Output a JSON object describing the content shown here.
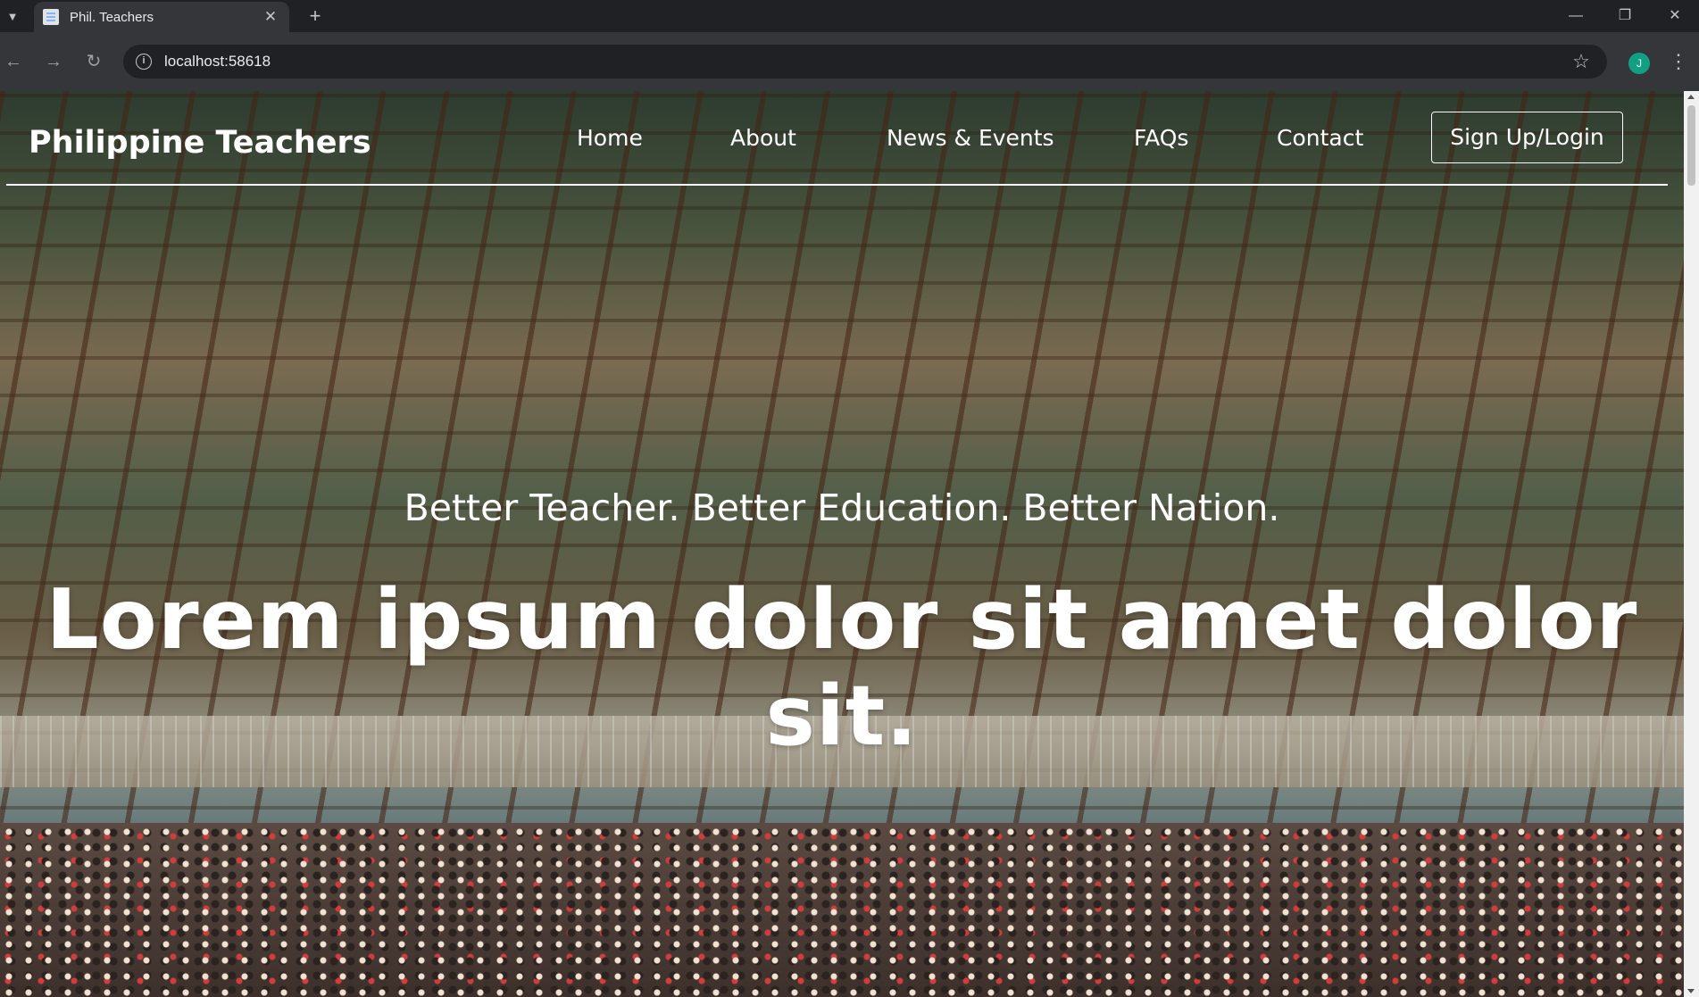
{
  "browser": {
    "tab_title": "Phil. Teachers",
    "url": "localhost:58618",
    "avatar_initial": "J"
  },
  "site": {
    "brand": "Philippine Teachers",
    "nav": [
      "Home",
      "About",
      "News & Events",
      "FAQs",
      "Contact"
    ],
    "signup_label": "Sign Up/Login"
  },
  "hero": {
    "tagline": "Better Teacher. Better Education. Better Nation.",
    "headline": "Lorem ipsum dolor sit amet dolor sit."
  }
}
